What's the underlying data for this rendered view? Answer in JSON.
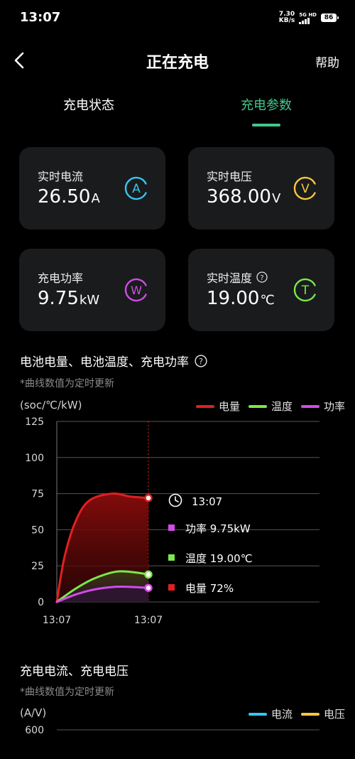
{
  "status_bar": {
    "time": "13:07",
    "net_speed_value": "7.30",
    "net_speed_unit": "KB/s",
    "signal_label": "5G HD",
    "battery": "86"
  },
  "header": {
    "title": "正在充电",
    "help": "帮助",
    "back_icon": "chevron-left-icon"
  },
  "tabs": [
    {
      "label": "充电状态",
      "active": false
    },
    {
      "label": "充电参数",
      "active": true
    }
  ],
  "colors": {
    "accent": "#43c78a",
    "current": "#38c6f0",
    "voltage": "#f5c842",
    "power": "#d24be8",
    "temperature": "#7be84b",
    "soc": "#e02020",
    "card_bg": "#1a1b1c"
  },
  "metrics": [
    {
      "title": "实时电流",
      "value": "26.50",
      "unit": "A",
      "icon_letter": "A",
      "icon": "current-icon"
    },
    {
      "title": "实时电压",
      "value": "368.00",
      "unit": "V",
      "icon_letter": "V",
      "icon": "voltage-icon"
    },
    {
      "title": "充电功率",
      "value": "9.75",
      "unit": "kW",
      "icon_letter": "W",
      "icon": "power-icon"
    },
    {
      "title": "实时温度",
      "value": "19.00",
      "unit": "℃",
      "icon_letter": "T",
      "icon": "temperature-icon",
      "has_help": true
    }
  ],
  "chart1": {
    "title": "电池电量、电池温度、充电功率",
    "note": "*曲线数值为定时更新",
    "unit_label": "(soc/℃/kW)",
    "legend": [
      "电量",
      "温度",
      "功率"
    ],
    "tooltip": {
      "time": "13:07",
      "power": "功率 9.75kW",
      "temperature": "温度 19.00℃",
      "soc": "电量 72%"
    }
  },
  "chart2": {
    "title": "充电电流、充电电压",
    "note": "*曲线数值为定时更新",
    "unit_label": "(A/V)",
    "legend": [
      "电流",
      "电压"
    ],
    "top_tick": "600"
  },
  "chart_data": [
    {
      "type": "line",
      "x": [
        "13:07",
        "13:07"
      ],
      "xticks": [
        "13:07",
        "13:07"
      ],
      "yticks": [
        0,
        25,
        50,
        75,
        100,
        125
      ],
      "ylim": [
        0,
        125
      ],
      "grid": true,
      "legend_position": "top-right",
      "series": [
        {
          "name": "电量",
          "color": "#e02020",
          "points": [
            [
              0,
              0
            ],
            [
              0.08,
              30
            ],
            [
              0.2,
              55
            ],
            [
              0.35,
              70
            ],
            [
              0.6,
              75
            ],
            [
              0.8,
              73
            ],
            [
              1,
              72
            ]
          ]
        },
        {
          "name": "温度",
          "color": "#7be84b",
          "points": [
            [
              0,
              0
            ],
            [
              0.2,
              9
            ],
            [
              0.4,
              16
            ],
            [
              0.65,
              21
            ],
            [
              0.85,
              20.5
            ],
            [
              1,
              19
            ]
          ]
        },
        {
          "name": "功率",
          "color": "#d24be8",
          "points": [
            [
              0,
              0
            ],
            [
              0.2,
              5
            ],
            [
              0.4,
              8.5
            ],
            [
              0.65,
              10.5
            ],
            [
              0.85,
              10.3
            ],
            [
              1,
              9.75
            ]
          ]
        }
      ]
    },
    {
      "type": "line",
      "yticks": [
        600
      ],
      "grid": true,
      "legend_position": "top-right",
      "series": [
        {
          "name": "电流",
          "color": "#38c6f0",
          "points": []
        },
        {
          "name": "电压",
          "color": "#f5c842",
          "points": []
        }
      ]
    }
  ]
}
